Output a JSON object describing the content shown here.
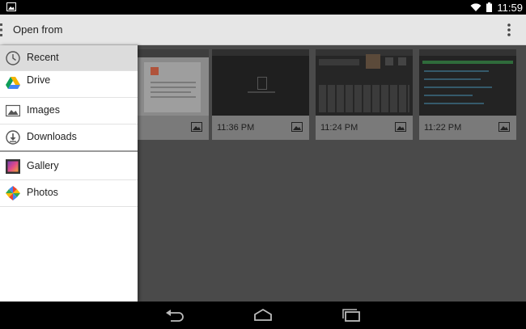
{
  "status_bar": {
    "time": "11:59",
    "icons": [
      "image-icon",
      "wifi-icon",
      "battery-icon"
    ]
  },
  "action_bar": {
    "title": "Open from",
    "icons": [
      "nav-drawer-icon",
      "overflow-menu-icon"
    ]
  },
  "drawer": {
    "items": [
      {
        "label": "Recent",
        "icon": "clock-icon",
        "selected": true
      },
      {
        "label": "Drive",
        "icon": "drive-icon"
      },
      {
        "label": "Images",
        "icon": "image-icon"
      },
      {
        "label": "Downloads",
        "icon": "download-icon"
      },
      {
        "label": "Gallery",
        "icon": "gallery-icon"
      },
      {
        "label": "Photos",
        "icon": "photos-icon"
      }
    ]
  },
  "thumbnails": [
    {
      "time": "PM"
    },
    {
      "time": "11:36 PM"
    },
    {
      "time": "11:24 PM"
    },
    {
      "time": "11:22 PM"
    }
  ],
  "nav_bar": {
    "icons": [
      "back-icon",
      "home-icon",
      "recents-icon"
    ]
  },
  "colors": {
    "action_bar_bg": "#e6e6e6",
    "drawer_bg": "#ffffff",
    "content_dim": "#4a4a4a",
    "selected_item": "#dcdcdc"
  }
}
